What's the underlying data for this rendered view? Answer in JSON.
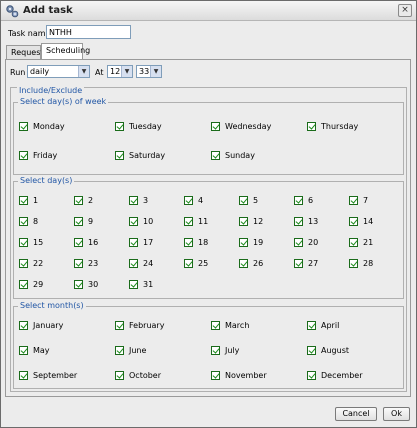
{
  "window": {
    "title": "Add task",
    "close_glyph": "×",
    "icon": "gear-icon"
  },
  "task": {
    "label": "Task name",
    "value": "NTHH"
  },
  "tabs": [
    {
      "label": "Request"
    },
    {
      "label": "Scheduling"
    }
  ],
  "run": {
    "label": "Run",
    "value": "daily",
    "at_label": "At",
    "hour": "12",
    "minute": "33"
  },
  "include_exclude": {
    "legend": "Include/Exclude"
  },
  "weekdays": {
    "legend": "Select day(s) of week",
    "items": [
      "Monday",
      "Tuesday",
      "Wednesday",
      "Thursday",
      "Friday",
      "Saturday",
      "Sunday"
    ]
  },
  "days": {
    "legend": "Select day(s)",
    "items": [
      "1",
      "2",
      "3",
      "4",
      "5",
      "6",
      "7",
      "8",
      "9",
      "10",
      "11",
      "12",
      "13",
      "14",
      "15",
      "16",
      "17",
      "18",
      "19",
      "20",
      "21",
      "22",
      "23",
      "24",
      "25",
      "26",
      "27",
      "28",
      "29",
      "30",
      "31"
    ]
  },
  "months": {
    "legend": "Select month(s)",
    "items": [
      "January",
      "February",
      "March",
      "April",
      "May",
      "June",
      "July",
      "August",
      "September",
      "October",
      "November",
      "December"
    ]
  },
  "buttons": {
    "cancel": "Cancel",
    "ok": "Ok"
  },
  "colors": {
    "legend": "#2156a5",
    "check": "#1a8a1a"
  }
}
